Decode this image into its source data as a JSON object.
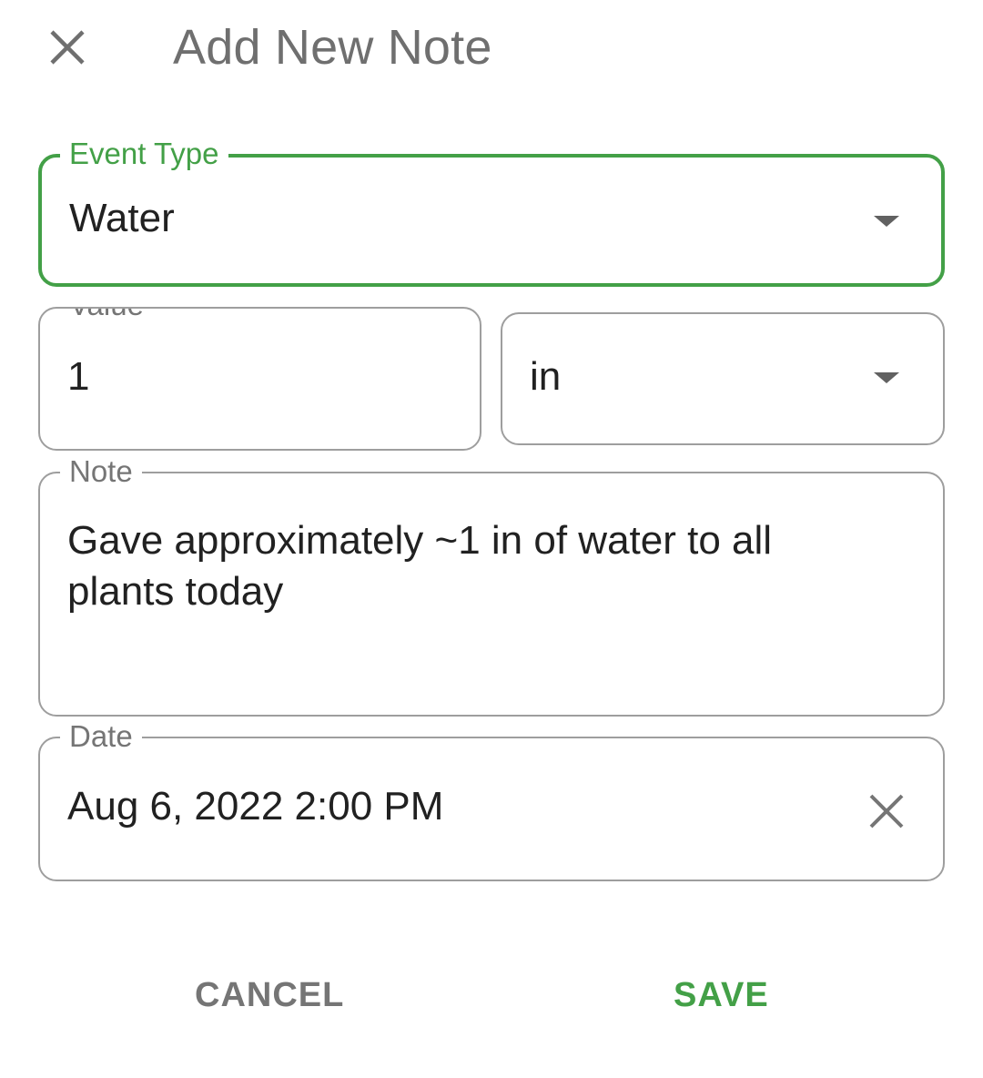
{
  "dialog": {
    "title": "Add New Note",
    "close_icon": "close-icon"
  },
  "event_type": {
    "label": "Event Type",
    "value": "Water",
    "icon": "dropdown-arrow-icon"
  },
  "value_field": {
    "label": "Value",
    "value": "1"
  },
  "unit_field": {
    "value": "in",
    "icon": "dropdown-arrow-icon"
  },
  "note_field": {
    "label": "Note",
    "value": "Gave approximately ~1 in of water to all plants today"
  },
  "date_field": {
    "label": "Date",
    "value": "Aug 6, 2022 2:00 PM",
    "clear_icon": "clear-icon"
  },
  "actions": {
    "cancel_label": "CANCEL",
    "save_label": "SAVE"
  },
  "colors": {
    "accent": "#43a047",
    "title": "#6f6f6f",
    "border": "#9e9e9e"
  }
}
